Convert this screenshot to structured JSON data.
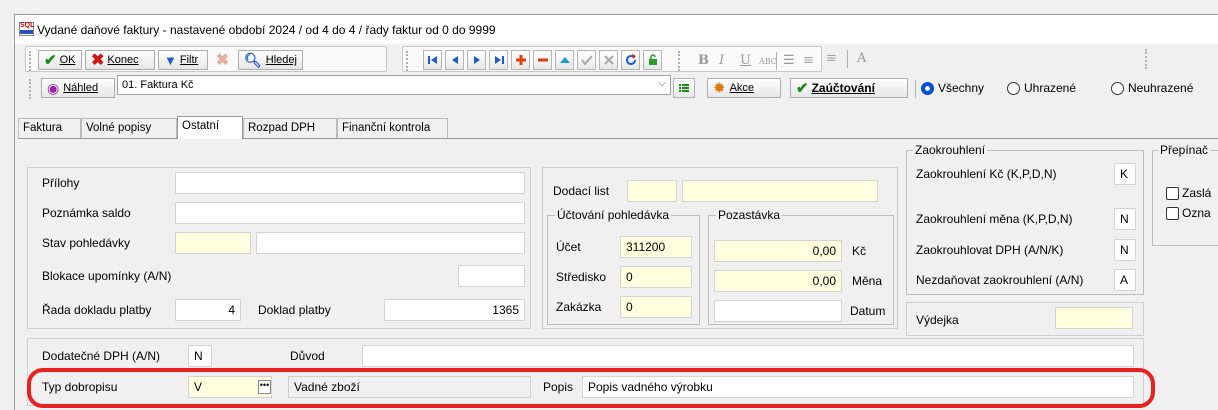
{
  "window": {
    "title": "Vydané daňové faktury - nastavené období 2024 / od 4 do 4 / řady faktur od 0 do 9999",
    "app_icon_text": "SQL"
  },
  "toolbar1": {
    "ok_label": "OK",
    "konec_label": "Konec",
    "filtr_label": "Filtr",
    "hledej_label": "Hledej",
    "format_buttons": [
      "B",
      "I",
      "U",
      "ABC",
      "A"
    ]
  },
  "toolbar2": {
    "nahled_label": "Náhled",
    "report_value": "01. Faktura Kč",
    "akce_label": "Akce",
    "zauctovani_label": "Zaúčtování",
    "radios": [
      {
        "label": "Všechny",
        "selected": true
      },
      {
        "label": "Uhrazené",
        "selected": false
      },
      {
        "label": "Neuhrazené",
        "selected": false
      }
    ]
  },
  "tabs": [
    "Faktura",
    "Volné popisy",
    "Ostatní",
    "Rozpad DPH",
    "Finanční kontrola"
  ],
  "active_tab": "Ostatní",
  "form": {
    "prilohy_label": "Přílohy",
    "poznamka_label": "Poznámka saldo",
    "stav_label": "Stav pohledávky",
    "blokace_label": "Blokace upomínky (A/N)",
    "rada_label": "Řada dokladu platby",
    "rada_value": "4",
    "doklad_label": "Doklad platby",
    "doklad_value": "1365",
    "dodaci_label": "Dodací list",
    "uctovani_group": "Účtování pohledávka",
    "ucet_label": "Účet",
    "ucet_value": "311200",
    "stredisko_label": "Středisko",
    "stredisko_value": "0",
    "zakazka_label": "Zakázka",
    "zakazka_value": "0",
    "pozastavka_group": "Pozastávka",
    "pozastavka_kc_value": "0,00",
    "pozastavka_kc_label": "Kč",
    "pozastavka_mena_value": "0,00",
    "pozastavka_mena_label": "Měna",
    "datum_label": "Datum",
    "zaokrouhleni_group": "Zaokrouhlení",
    "zaokr_kc_label": "Zaokrouhlení Kč (K,P,D,N)",
    "zaokr_kc_value": "K",
    "zaokr_mena_label": "Zaokrouhlení měna (K,P,D,N)",
    "zaokr_mena_value": "N",
    "zaokr_dph_label": "Zaokrouhlovat DPH (A/N/K)",
    "zaokr_dph_value": "N",
    "nezdanovat_label": "Nezdaňovat zaokrouhlení (A/N)",
    "nezdanovat_value": "A",
    "vydejka_label": "Výdejka",
    "prepinace_group": "Přepínač",
    "check1_label": "Zaslá",
    "check2_label": "Ozna",
    "dodatecne_label": "Dodatečné DPH (A/N)",
    "dodatecne_value": "N",
    "duvod_label": "Důvod",
    "typ_label": "Typ dobropisu",
    "typ_value": "V",
    "typ_desc": "Vadné zboží",
    "popis_label": "Popis",
    "popis_value": "Popis vadného výrobku"
  },
  "colors": {
    "highlight_frame": "#e8201e",
    "required_field": "#ffffdf",
    "radio_selected": "#0050d8"
  }
}
